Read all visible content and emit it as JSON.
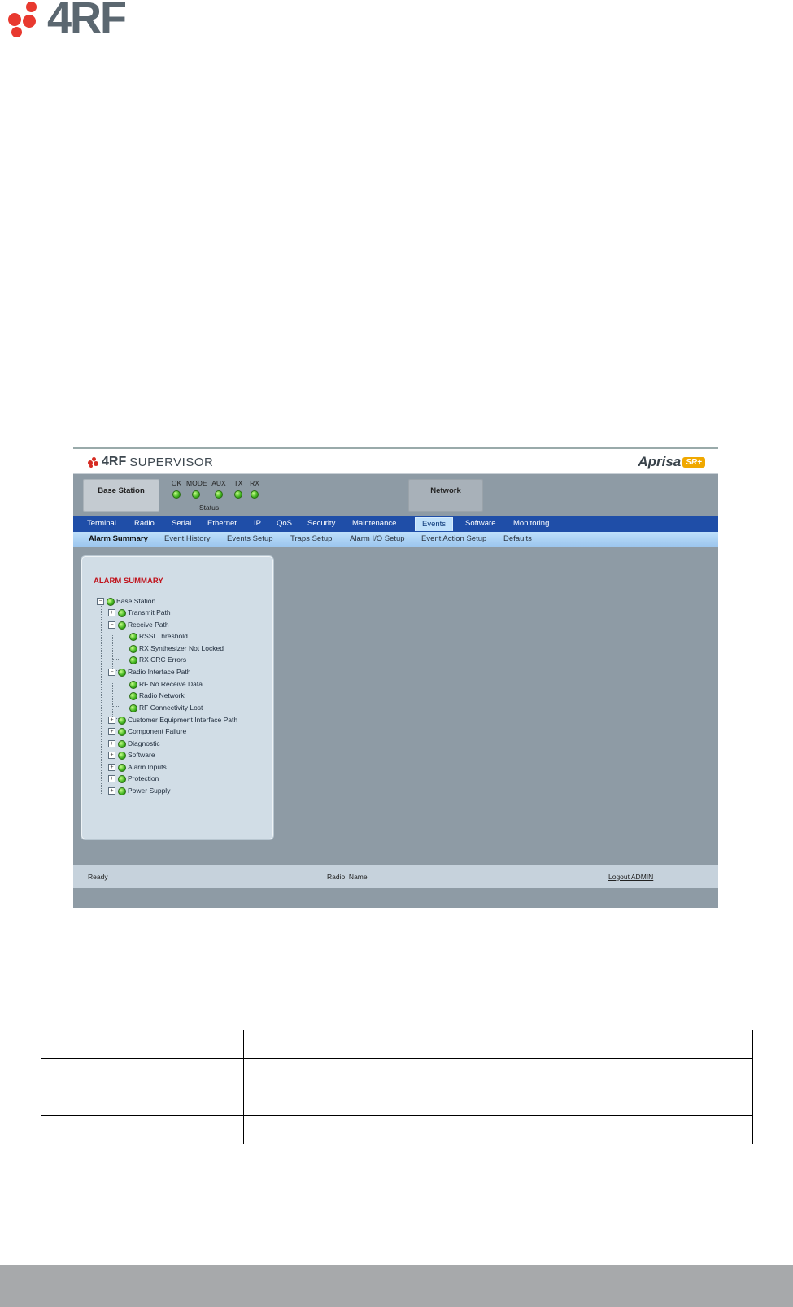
{
  "document": {
    "logo_text": "4RF"
  },
  "screenshot": {
    "header": {
      "logo_brand": "4RF",
      "logo_product": "SUPERVISOR",
      "product_name": "Aprisa",
      "product_badge": "SR+"
    },
    "status_area": {
      "station_label": "Base Station",
      "network_label": "Network",
      "leds": [
        "OK",
        "MODE",
        "AUX",
        "TX",
        "RX"
      ],
      "status_label": "Status"
    },
    "menu": {
      "items": [
        "Terminal",
        "Radio",
        "Serial",
        "Ethernet",
        "IP",
        "QoS",
        "Security",
        "Maintenance",
        "Events",
        "Software",
        "Monitoring"
      ],
      "active": "Events"
    },
    "submenu": {
      "items": [
        "Alarm Summary",
        "Event History",
        "Events Setup",
        "Traps Setup",
        "Alarm I/O Setup",
        "Event Action Setup",
        "Defaults"
      ],
      "active": "Alarm Summary"
    },
    "panel": {
      "title": "ALARM SUMMARY",
      "tree": [
        {
          "label": "Base Station",
          "toggle": "-"
        },
        {
          "label": "Transmit Path",
          "toggle": "+"
        },
        {
          "label": "Receive Path",
          "toggle": "-"
        },
        {
          "label": "RSSI Threshold",
          "toggle": ""
        },
        {
          "label": "RX Synthesizer Not Locked",
          "toggle": ""
        },
        {
          "label": "RX CRC Errors",
          "toggle": ""
        },
        {
          "label": "Radio Interface Path",
          "toggle": "-"
        },
        {
          "label": "RF No Receive Data",
          "toggle": ""
        },
        {
          "label": "Radio Network",
          "toggle": ""
        },
        {
          "label": "RF Connectivity Lost",
          "toggle": ""
        },
        {
          "label": "Customer Equipment Interface Path",
          "toggle": "+"
        },
        {
          "label": "Component Failure",
          "toggle": "+"
        },
        {
          "label": "Diagnostic",
          "toggle": "+"
        },
        {
          "label": "Software",
          "toggle": "+"
        },
        {
          "label": "Alarm Inputs",
          "toggle": "+"
        },
        {
          "label": "Protection",
          "toggle": "+"
        },
        {
          "label": "Power Supply",
          "toggle": "+"
        }
      ]
    },
    "footer": {
      "status": "Ready",
      "radio_name": "Radio: Name",
      "logout": "Logout ADMIN"
    }
  },
  "colors": {
    "menu_bar": "#1f4ea8",
    "alarm_title": "#c0121b",
    "led_ok": "#3fb21e",
    "page_footer": "#a7a9ab"
  }
}
